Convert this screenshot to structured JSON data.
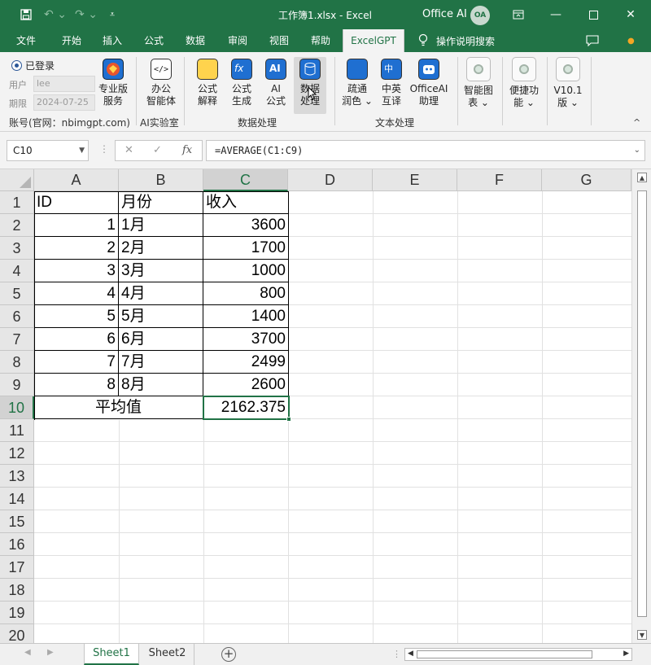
{
  "window": {
    "doc_title": "工作簿1.xlsx  -  Excel",
    "office_ai_label": "Office AI",
    "avatar_text": "OA"
  },
  "tabs": [
    {
      "label": "文件"
    },
    {
      "label": "开始"
    },
    {
      "label": "插入"
    },
    {
      "label": "公式"
    },
    {
      "label": "数据"
    },
    {
      "label": "审阅"
    },
    {
      "label": "视图"
    },
    {
      "label": "帮助"
    },
    {
      "label": "ExcelGPT",
      "active": true
    }
  ],
  "tab_search": "操作说明搜索",
  "ribbon": {
    "login": {
      "status": "已登录",
      "user_label": "用户",
      "user_value": "lee",
      "date_label": "期限",
      "date_value": "2024-07-25",
      "account": "账号(官网：nbimgpt.com)"
    },
    "pro": {
      "line1": "专业版",
      "line2": "服务"
    },
    "office": {
      "line1": "办公",
      "line2": "智能体"
    },
    "ai_lab_group": "AI实验室",
    "data_buttons": [
      {
        "line1": "公式",
        "line2": "解释"
      },
      {
        "line1": "公式",
        "line2": "生成"
      },
      {
        "line1": "AI",
        "line2": "公式"
      },
      {
        "line1": "数据",
        "line2": "处理"
      }
    ],
    "data_group": "数据处理",
    "text_buttons": [
      {
        "line1": "疏通",
        "line2": "润色 ⌄"
      },
      {
        "line1": "中英",
        "line2": "互译"
      },
      {
        "line1": "OfficeAI",
        "line2": "助理"
      }
    ],
    "text_group": "文本处理",
    "extra_buttons": [
      {
        "line1": "智能图",
        "line2": "表 ⌄"
      },
      {
        "line1": "便捷功",
        "line2": "能 ⌄"
      },
      {
        "line1": "V10.1",
        "line2": "版 ⌄"
      }
    ]
  },
  "formula_bar": {
    "name_box": "C10",
    "formula": "=AVERAGE(C1:C9)"
  },
  "columns": [
    "A",
    "B",
    "C",
    "D",
    "E",
    "F",
    "G"
  ],
  "rows": [
    "1",
    "2",
    "3",
    "4",
    "5",
    "6",
    "7",
    "8",
    "9",
    "10",
    "11",
    "12",
    "13",
    "14",
    "15",
    "16",
    "17",
    "18",
    "19",
    "20"
  ],
  "table": {
    "header": [
      "ID",
      "月份",
      "收入"
    ],
    "data": [
      [
        "1",
        "1月",
        "3600"
      ],
      [
        "2",
        "2月",
        "1700"
      ],
      [
        "3",
        "3月",
        "1000"
      ],
      [
        "4",
        "4月",
        "800"
      ],
      [
        "5",
        "5月",
        "1400"
      ],
      [
        "6",
        "6月",
        "3700"
      ],
      [
        "7",
        "7月",
        "2499"
      ],
      [
        "8",
        "8月",
        "2600"
      ]
    ],
    "avg_label": "平均值",
    "avg_value": "2162.375"
  },
  "sheets": [
    "Sheet1",
    "Sheet2"
  ]
}
